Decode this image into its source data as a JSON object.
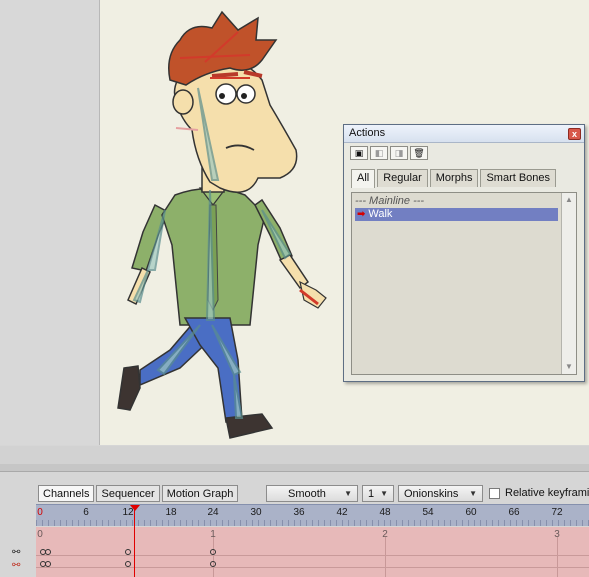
{
  "actions_window": {
    "title": "Actions",
    "close": "x",
    "toolbar_icons": [
      "new-action-icon",
      "duplicate-action-icon",
      "copy-action-icon",
      "delete-action-icon"
    ],
    "tabs": [
      {
        "label": "All",
        "active": true
      },
      {
        "label": "Regular",
        "active": false
      },
      {
        "label": "Morphs",
        "active": false
      },
      {
        "label": "Smart Bones",
        "active": false
      }
    ],
    "list_header": "--- Mainline ---",
    "items": [
      {
        "label": "Walk",
        "selected": true,
        "active_marker": "➡"
      }
    ],
    "scroll_up": "▲",
    "scroll_down": "▼"
  },
  "timeline": {
    "tabs": [
      {
        "label": "Channels",
        "active": true
      },
      {
        "label": "Sequencer",
        "active": false
      },
      {
        "label": "Motion Graph",
        "active": false
      }
    ],
    "interpolation": {
      "value": "Smooth",
      "arrow": "▼"
    },
    "step": {
      "value": "1",
      "arrow": "▼"
    },
    "onionskins": {
      "label": "Onionskins",
      "arrow": "▼"
    },
    "relative_keyframing": {
      "label": "Relative keyframin",
      "checked": false
    },
    "ruler_numbers": [
      "0",
      "6",
      "12",
      "18",
      "24",
      "30",
      "36",
      "42",
      "48",
      "54",
      "60",
      "66",
      "72"
    ],
    "track_frame_labels": [
      "0",
      "1",
      "2",
      "3"
    ],
    "current_frame": 12
  },
  "colors": {
    "stage_bg": "#f0efe3",
    "selection": "#727fc2",
    "playhead": "#e00000",
    "ruler_bg": "#aab2c8",
    "track_bg": "#e7b9b9"
  }
}
